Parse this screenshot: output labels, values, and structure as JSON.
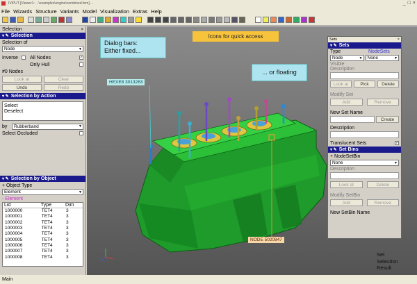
{
  "window": {
    "title": "IViPUT [Viewer1: ...\\examples\\engine\\combined.fem] ...",
    "controls": [
      "_",
      "□",
      "×"
    ]
  },
  "menu": [
    "File",
    "Wizards",
    "Structure",
    "Variants",
    "Model",
    "Visualization",
    "Extras",
    "Help"
  ],
  "callouts": {
    "dialog_bars": [
      "Dialog bars:",
      "Either fixed..."
    ],
    "quick_access": "Icons for quick access",
    "floating": "... or floating"
  },
  "left_panel": {
    "header": "Selection",
    "selection_bar": "Selection",
    "selection_of_label": "Selection of",
    "selection_of_value": "Node",
    "inverse_label": "Inverse",
    "all_nodes_label": "All Nodes",
    "only_hull_label": "Only Hull",
    "count_label": "#0 Nodes",
    "look_at": "Look at",
    "clear": "Clear",
    "undo": "Undo",
    "redo": "Redo",
    "action_bar": "Selection by Action",
    "actions": [
      "Select",
      "Deselect"
    ],
    "by_label": "by",
    "by_value": "Rubberband",
    "select_occluded": "Select Occluded",
    "object_bar": "Selection by Object",
    "object_type_label": "+ Object Type",
    "object_type_value": "Element",
    "element_label": "- Element",
    "table": {
      "columns": [
        "Lid",
        "Type",
        "Dim"
      ],
      "rows": [
        [
          "1000000",
          "TET4",
          "3"
        ],
        [
          "1000001",
          "TET4",
          "3"
        ],
        [
          "1000002",
          "TET4",
          "3"
        ],
        [
          "1000003",
          "TET4",
          "3"
        ],
        [
          "1000004",
          "TET4",
          "3"
        ],
        [
          "1000005",
          "TET4",
          "3"
        ],
        [
          "1000006",
          "TET4",
          "3"
        ],
        [
          "1000007",
          "TET4",
          "3"
        ],
        [
          "1000008",
          "TET4",
          "3"
        ]
      ]
    }
  },
  "viewport": {
    "hexa_tag": "HEXE8   3013263",
    "node_tag": "NODE   5020847"
  },
  "sets_window": {
    "title": "Sets",
    "bar": "Sets",
    "type_label": "Type",
    "nodesets_label": "NodeSets",
    "type_value": "Node",
    "nodesets_value": "None",
    "visible_label": "Visible",
    "description_label": "Description",
    "look_at": "Look at",
    "pick": "Pick",
    "delete": "Delete",
    "modify_set": "Modify Set",
    "add": "Add",
    "remove": "Remove",
    "new_set_name": "New Set Name",
    "create": "Create",
    "description2": "Description",
    "translucent_sets": "Translucent Sets",
    "bins_bar": "Set Bins",
    "nodesetbin_label": "+ NodeSetBin",
    "bin_value": "None",
    "description3": "Description",
    "look_at2": "Look at",
    "delete2": "Delete",
    "modify_setbin": "Modify SetBin",
    "add2": "Add",
    "remove2": "Remove",
    "new_setbin_name": "New SetBin Name"
  },
  "right_labels": [
    "Set",
    "Selection",
    "Result"
  ],
  "status": "Main"
}
